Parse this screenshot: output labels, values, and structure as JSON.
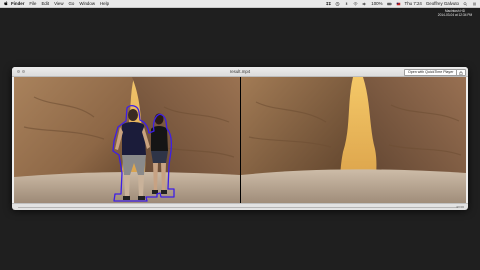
{
  "menubar": {
    "app_name": "Finder",
    "items": [
      "File",
      "Edit",
      "View",
      "Go",
      "Window",
      "Help"
    ],
    "status": {
      "battery": "100%",
      "clock": "Thu 7:24",
      "user": "Geoffrey Galvuto"
    }
  },
  "desktop": {
    "icon_label_line1": "Macintosh HD",
    "icon_label_line2": "2014-03-04 at 12:34 PM"
  },
  "window": {
    "title": "result.mp4",
    "quicktime_button": "Open with QuickTime Player",
    "timecode": "00:00"
  },
  "colors": {
    "mask_outline": "#3d1ee6",
    "menubar_bg": "#e9e9e9",
    "desktop_bg": "#1f1f1f"
  }
}
